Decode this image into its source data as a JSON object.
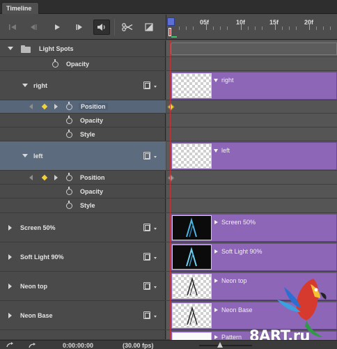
{
  "panel": {
    "tab_title": "Timeline"
  },
  "toolbar": {
    "icons": [
      "go-to-first-frame-icon",
      "previous-frame-icon",
      "play-icon",
      "next-frame-icon",
      "audio-icon",
      "split-scissors-icon",
      "transition-icon"
    ]
  },
  "ruler": {
    "labels": [
      "05f",
      "10f",
      "15f",
      "20f"
    ]
  },
  "layers": {
    "light_spots": {
      "name": "Light Spots",
      "opacity": "Opacity"
    },
    "right": {
      "name": "right",
      "position": "Position",
      "opacity": "Opacity",
      "style": "Style"
    },
    "left": {
      "name": "left",
      "position": "Position",
      "opacity": "Opacity",
      "style": "Style"
    },
    "screen50": {
      "name": "Screen 50%"
    },
    "softlight90": {
      "name": "Soft Light 90%"
    },
    "neon_top": {
      "name": "Neon top"
    },
    "neon_base": {
      "name": "Neon Base"
    }
  },
  "clips": {
    "right": "right",
    "left": "left",
    "screen50": "Screen 50%",
    "softlight90": "Soft Light 90%",
    "neon_top": "Neon top",
    "neon_base": "Neon Base",
    "pattern": "Pattern"
  },
  "footer": {
    "timecode": "0:00:00:00",
    "fps": "(30.00 fps)"
  },
  "watermark": {
    "text": "8ART.ru"
  },
  "colors": {
    "clip_purple": "#8e66b8",
    "playhead_red": "#c23535",
    "keyframe_yellow": "#f2d23c",
    "selection_blue": "#5c6b7d"
  }
}
